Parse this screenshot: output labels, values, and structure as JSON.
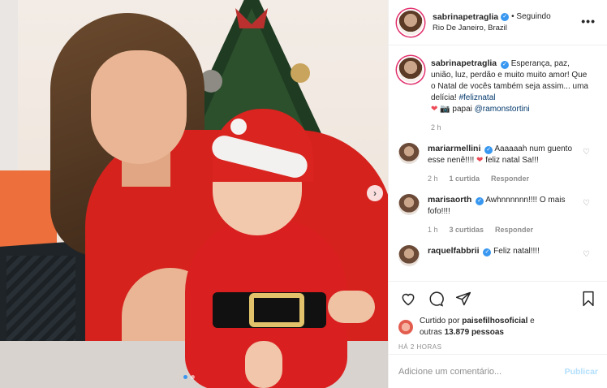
{
  "post": {
    "author": "sabrinapetraglia",
    "follow_status": "• Seguindo",
    "location": "Rio De Janeiro, Brazil",
    "more_label": "•••"
  },
  "caption": {
    "username": "sabrinapetraglia",
    "text_part1": "Esperança, paz, união, luz, perdão e muito muito amor! Que o Natal de vocês também seja assim... uma delícia! ",
    "hashtag": "#feliznatal",
    "text_part2": " 📷 papai ",
    "mention": "@ramonstortini",
    "age": "2 h"
  },
  "comments": [
    {
      "username": "mariarmellini",
      "text_a": "Aaaaaah num guento esse nenê!!!! ",
      "text_b": " feliz natal Sa!!!",
      "age": "2 h",
      "likes": "1 curtida",
      "reply": "Responder"
    },
    {
      "username": "marisaorth",
      "text_a": "Awhnnnnnn!!!! O mais fofo!!!!",
      "text_b": "",
      "age": "1 h",
      "likes": "3 curtidas",
      "reply": "Responder"
    },
    {
      "username": "raquelfabbrii",
      "text_a": "Feliz natal!!!!",
      "text_b": "",
      "age": "",
      "likes": "",
      "reply": ""
    }
  ],
  "likes": {
    "prefix": "Curtido por ",
    "user": "paisefilhosoficial",
    "middle": " e",
    "line2_prefix": "outras ",
    "count": "13.879 pessoas"
  },
  "time_label": "HÁ 2 HORAS",
  "comment_input": {
    "placeholder": "Adicione um comentário...",
    "submit": "Publicar"
  },
  "icons": [
    "heart-icon",
    "comment-icon",
    "share-icon",
    "bookmark-icon",
    "verified-icon",
    "chevron-right-icon"
  ],
  "colors": {
    "verified": "#3897f0",
    "heart": "#ed4956",
    "link": "#00376b",
    "publish": "#b2dffc",
    "muted": "#8e8e8e"
  }
}
